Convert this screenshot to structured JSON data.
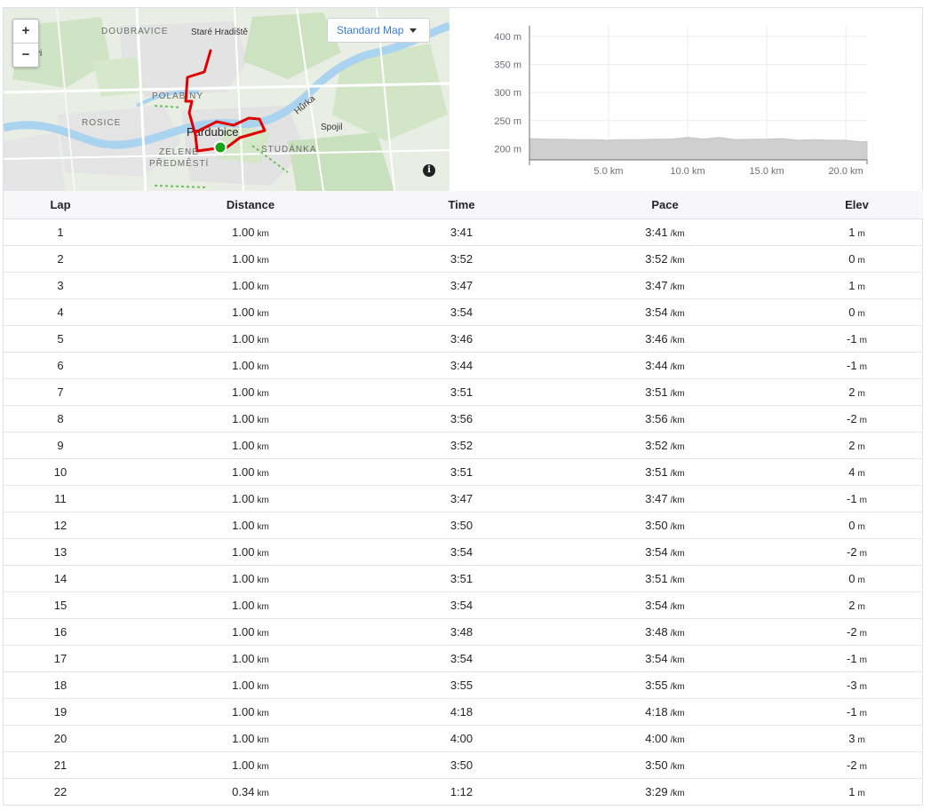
{
  "map": {
    "zoom_in": "+",
    "zoom_out": "−",
    "map_type": "Standard Map",
    "info": "i",
    "labels": {
      "doubravice": "DOUBRAVICE",
      "stare_hradiste": "Staré Hradiště",
      "polabiny": "POLABINY",
      "rosice": "ROSICE",
      "pardubice": "Pardubice",
      "zelene": "ZELENÉ",
      "predmesti": "PŘEDMĚSTÍ",
      "studanka": "STUDÁNKA",
      "hurka": "Hůrka",
      "spojil": "Spojil",
      "edge_vi": "vi"
    },
    "route_color": "#e00000",
    "start_marker_color": "#16a318"
  },
  "elevation_chart": {
    "y_ticks": [
      "400 m",
      "350 m",
      "300 m",
      "250 m",
      "200 m"
    ],
    "x_ticks": [
      "5.0 km",
      "10.0 km",
      "15.0 km",
      "20.0 km"
    ],
    "fill_color": "#cfcfcf",
    "chart_data": {
      "type": "area",
      "xlabel": "",
      "ylabel": "",
      "xlim": [
        0,
        21.34
      ],
      "ylim": [
        180,
        400
      ],
      "x": [
        0,
        1,
        2,
        3,
        4,
        5,
        6,
        7,
        8,
        9,
        10,
        11,
        12,
        13,
        14,
        15,
        16,
        17,
        18,
        19,
        20,
        21,
        21.34
      ],
      "y": [
        217,
        218,
        216,
        217,
        215,
        216,
        215,
        217,
        216,
        218,
        219,
        218,
        219,
        217,
        216,
        218,
        217,
        216,
        215,
        216,
        214,
        213,
        212
      ]
    }
  },
  "table": {
    "headers": {
      "lap": "Lap",
      "distance": "Distance",
      "time": "Time",
      "pace": "Pace",
      "elev": "Elev"
    },
    "units": {
      "distance": "km",
      "pace": "/km",
      "elev": "m"
    },
    "rows": [
      {
        "lap": "1",
        "distance": "1.00",
        "time": "3:41",
        "pace": "3:41",
        "elev": "1"
      },
      {
        "lap": "2",
        "distance": "1.00",
        "time": "3:52",
        "pace": "3:52",
        "elev": "0"
      },
      {
        "lap": "3",
        "distance": "1.00",
        "time": "3:47",
        "pace": "3:47",
        "elev": "1"
      },
      {
        "lap": "4",
        "distance": "1.00",
        "time": "3:54",
        "pace": "3:54",
        "elev": "0"
      },
      {
        "lap": "5",
        "distance": "1.00",
        "time": "3:46",
        "pace": "3:46",
        "elev": "-1"
      },
      {
        "lap": "6",
        "distance": "1.00",
        "time": "3:44",
        "pace": "3:44",
        "elev": "-1"
      },
      {
        "lap": "7",
        "distance": "1.00",
        "time": "3:51",
        "pace": "3:51",
        "elev": "2"
      },
      {
        "lap": "8",
        "distance": "1.00",
        "time": "3:56",
        "pace": "3:56",
        "elev": "-2"
      },
      {
        "lap": "9",
        "distance": "1.00",
        "time": "3:52",
        "pace": "3:52",
        "elev": "2"
      },
      {
        "lap": "10",
        "distance": "1.00",
        "time": "3:51",
        "pace": "3:51",
        "elev": "4"
      },
      {
        "lap": "11",
        "distance": "1.00",
        "time": "3:47",
        "pace": "3:47",
        "elev": "-1"
      },
      {
        "lap": "12",
        "distance": "1.00",
        "time": "3:50",
        "pace": "3:50",
        "elev": "0"
      },
      {
        "lap": "13",
        "distance": "1.00",
        "time": "3:54",
        "pace": "3:54",
        "elev": "-2"
      },
      {
        "lap": "14",
        "distance": "1.00",
        "time": "3:51",
        "pace": "3:51",
        "elev": "0"
      },
      {
        "lap": "15",
        "distance": "1.00",
        "time": "3:54",
        "pace": "3:54",
        "elev": "2"
      },
      {
        "lap": "16",
        "distance": "1.00",
        "time": "3:48",
        "pace": "3:48",
        "elev": "-2"
      },
      {
        "lap": "17",
        "distance": "1.00",
        "time": "3:54",
        "pace": "3:54",
        "elev": "-1"
      },
      {
        "lap": "18",
        "distance": "1.00",
        "time": "3:55",
        "pace": "3:55",
        "elev": "-3"
      },
      {
        "lap": "19",
        "distance": "1.00",
        "time": "4:18",
        "pace": "4:18",
        "elev": "-1"
      },
      {
        "lap": "20",
        "distance": "1.00",
        "time": "4:00",
        "pace": "4:00",
        "elev": "3"
      },
      {
        "lap": "21",
        "distance": "1.00",
        "time": "3:50",
        "pace": "3:50",
        "elev": "-2"
      },
      {
        "lap": "22",
        "distance": "0.34",
        "time": "1:12",
        "pace": "3:29",
        "elev": "1"
      }
    ]
  }
}
